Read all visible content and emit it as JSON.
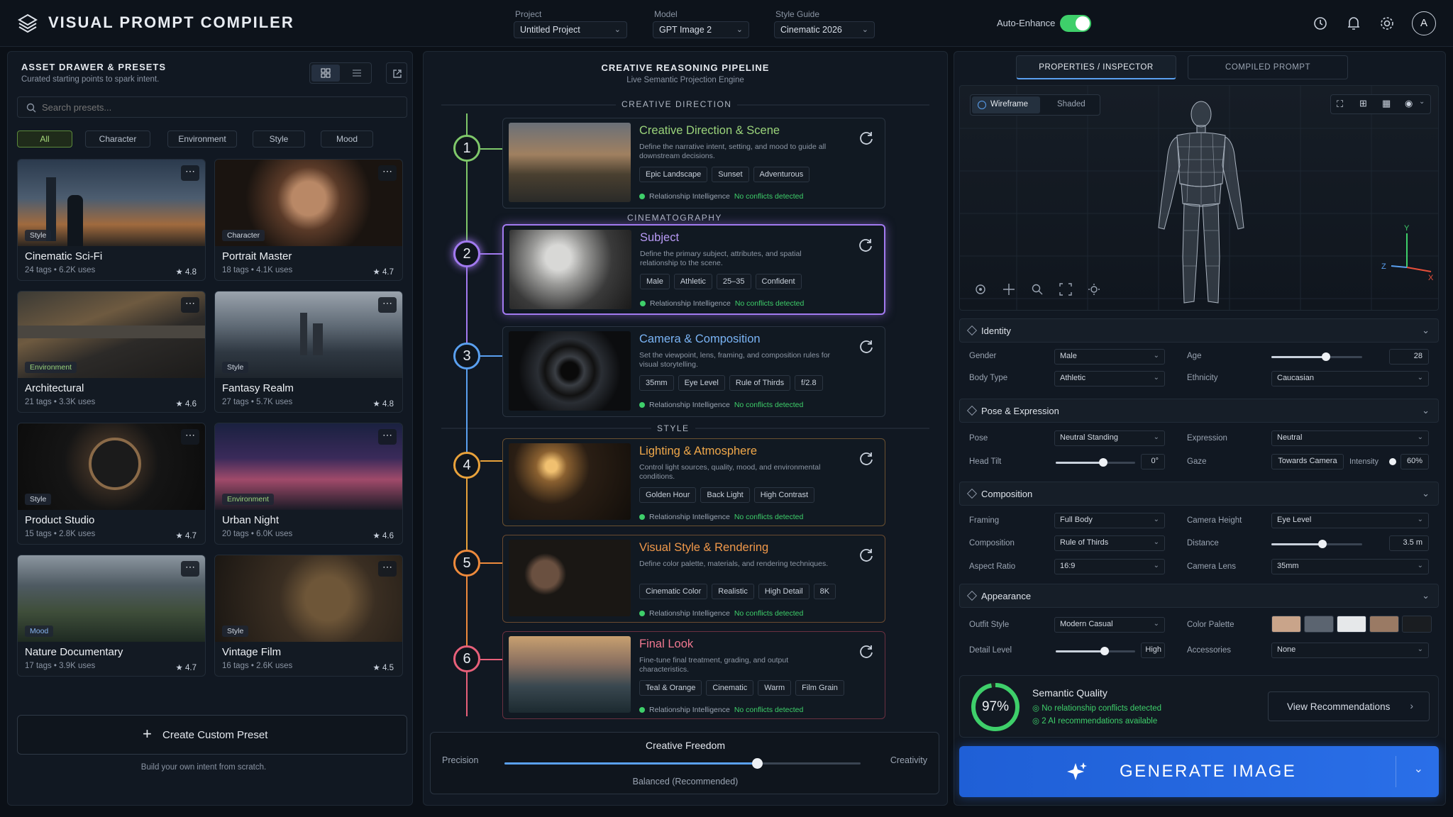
{
  "app": {
    "title": "VISUAL PROMPT COMPILER"
  },
  "topbar": {
    "project": {
      "label": "Project",
      "value": "Untitled Project"
    },
    "model": {
      "label": "Model",
      "value": "GPT Image 2"
    },
    "style_guide": {
      "label": "Style Guide",
      "value": "Cinematic 2026"
    },
    "auto_enhance": {
      "label": "Auto-Enhance",
      "on": true
    },
    "avatar": "A"
  },
  "drawer": {
    "title": "ASSET DRAWER & PRESETS",
    "subtitle": "Curated starting points to spark intent.",
    "search_placeholder": "Search presets...",
    "filters": [
      "All",
      "Character",
      "Environment",
      "Style",
      "Mood"
    ],
    "presets": [
      {
        "name": "Cinematic Sci-Fi",
        "badge": "Style",
        "meta": "24 tags • 6.2K uses",
        "rating": "★ 4.8"
      },
      {
        "name": "Portrait Master",
        "badge": "Character",
        "meta": "18 tags • 4.1K uses",
        "rating": "★ 4.7"
      },
      {
        "name": "Architectural",
        "badge": "Environment",
        "meta": "21 tags • 3.3K uses",
        "rating": "★ 4.6"
      },
      {
        "name": "Fantasy Realm",
        "badge": "Style",
        "meta": "27 tags • 5.7K uses",
        "rating": "★ 4.8"
      },
      {
        "name": "Product Studio",
        "badge": "Style",
        "meta": "15 tags • 2.8K uses",
        "rating": "★ 4.7"
      },
      {
        "name": "Urban Night",
        "badge": "Environment",
        "meta": "20 tags • 6.0K uses",
        "rating": "★ 4.6"
      },
      {
        "name": "Nature Documentary",
        "badge": "Mood",
        "meta": "17 tags • 3.9K uses",
        "rating": "★ 4.7"
      },
      {
        "name": "Vintage Film",
        "badge": "Style",
        "meta": "16 tags • 2.6K uses",
        "rating": "★ 4.5"
      }
    ],
    "create_button": "Create Custom Preset",
    "create_hint": "Build your own intent from scratch."
  },
  "pipeline": {
    "title": "CREATIVE REASONING PIPELINE",
    "subtitle": "Live Semantic Projection Engine",
    "sections": [
      "CREATIVE DIRECTION",
      "CINEMATOGRAPHY",
      "STYLE"
    ],
    "status_label": "Relationship Intelligence",
    "status_ok": "No conflicts detected",
    "steps": [
      {
        "num": "1",
        "title": "Creative Direction & Scene",
        "desc": "Define the narrative intent, setting, and mood to guide all downstream decisions.",
        "chips": [
          "Epic Landscape",
          "Sunset",
          "Adventurous"
        ],
        "color": "#7fc86a"
      },
      {
        "num": "2",
        "title": "Subject",
        "desc": "Define the primary subject, attributes, and spatial relationship to the scene.",
        "chips": [
          "Male",
          "Athletic",
          "25–35",
          "Confident"
        ],
        "color": "#a27af0"
      },
      {
        "num": "3",
        "title": "Camera & Composition",
        "desc": "Set the viewpoint, lens, framing, and composition rules for visual storytelling.",
        "chips": [
          "35mm",
          "Eye Level",
          "Rule of Thirds",
          "f/2.8"
        ],
        "color": "#5aa0f0"
      },
      {
        "num": "4",
        "title": "Lighting & Atmosphere",
        "desc": "Control light sources, quality, mood, and environmental conditions.",
        "chips": [
          "Golden Hour",
          "Back Light",
          "High Contrast"
        ],
        "color": "#e9a23b"
      },
      {
        "num": "5",
        "title": "Visual Style & Rendering",
        "desc": "Define color palette, materials, and rendering techniques.",
        "chips": [
          "Cinematic Color",
          "Realistic",
          "High Detail",
          "8K"
        ],
        "color": "#ee8a3c"
      },
      {
        "num": "6",
        "title": "Final Look",
        "desc": "Fine-tune final treatment, grading, and output characteristics.",
        "chips": [
          "Teal & Orange",
          "Cinematic",
          "Warm",
          "Film Grain"
        ],
        "color": "#e8607a"
      }
    ],
    "freedom": {
      "title": "Creative Freedom",
      "left": "Precision",
      "right": "Creativity",
      "value_label": "Balanced (Recommended)",
      "level": 0.71
    }
  },
  "inspector": {
    "tabs": [
      "PROPERTIES / INSPECTOR",
      "COMPILED PROMPT"
    ],
    "view_modes": [
      "Wireframe",
      "Shaded"
    ],
    "axes": {
      "y": "Y",
      "z": "Z",
      "x": "X"
    },
    "identity": {
      "title": "Identity",
      "gender_label": "Gender",
      "gender": "Male",
      "age_label": "Age",
      "age": "28",
      "age_level": 0.6,
      "body_label": "Body Type",
      "body": "Athletic",
      "ethnicity_label": "Ethnicity",
      "ethnicity": "Caucasian"
    },
    "pose": {
      "title": "Pose & Expression",
      "pose_label": "Pose",
      "pose": "Neutral Standing",
      "expression_label": "Expression",
      "expression": "Neutral",
      "tilt_label": "Head Tilt",
      "tilt": "0°",
      "tilt_level": 0.6,
      "gaze_label": "Gaze",
      "gaze": "Towards Camera",
      "intensity_label": "Intensity",
      "intensity": "60%"
    },
    "composition": {
      "title": "Composition",
      "framing_label": "Framing",
      "framing": "Full Body",
      "cam_height_label": "Camera Height",
      "cam_height": "Eye Level",
      "comp_label": "Composition",
      "comp": "Rule of Thirds",
      "distance_label": "Distance",
      "distance": "3.5 m",
      "distance_level": 0.56,
      "aspect_label": "Aspect Ratio",
      "aspect": "16:9",
      "lens_label": "Camera Lens",
      "lens": "35mm"
    },
    "appearance": {
      "title": "Appearance",
      "outfit_label": "Outfit Style",
      "outfit": "Modern Casual",
      "palette_label": "Color Palette",
      "palette": [
        "#c9a48a",
        "#5b6470",
        "#e6e8ea",
        "#9a7a64",
        "#1a1d21"
      ],
      "detail_label": "Detail Level",
      "detail": "High",
      "detail_level": 0.62,
      "accessories_label": "Accessories",
      "accessories": "None"
    },
    "quality": {
      "score": "97%",
      "score_level": 0.97,
      "title": "Semantic Quality",
      "line1": "No relationship conflicts detected",
      "line2": "2 AI recommendations available",
      "button": "View Recommendations"
    },
    "generate": "GENERATE IMAGE"
  }
}
